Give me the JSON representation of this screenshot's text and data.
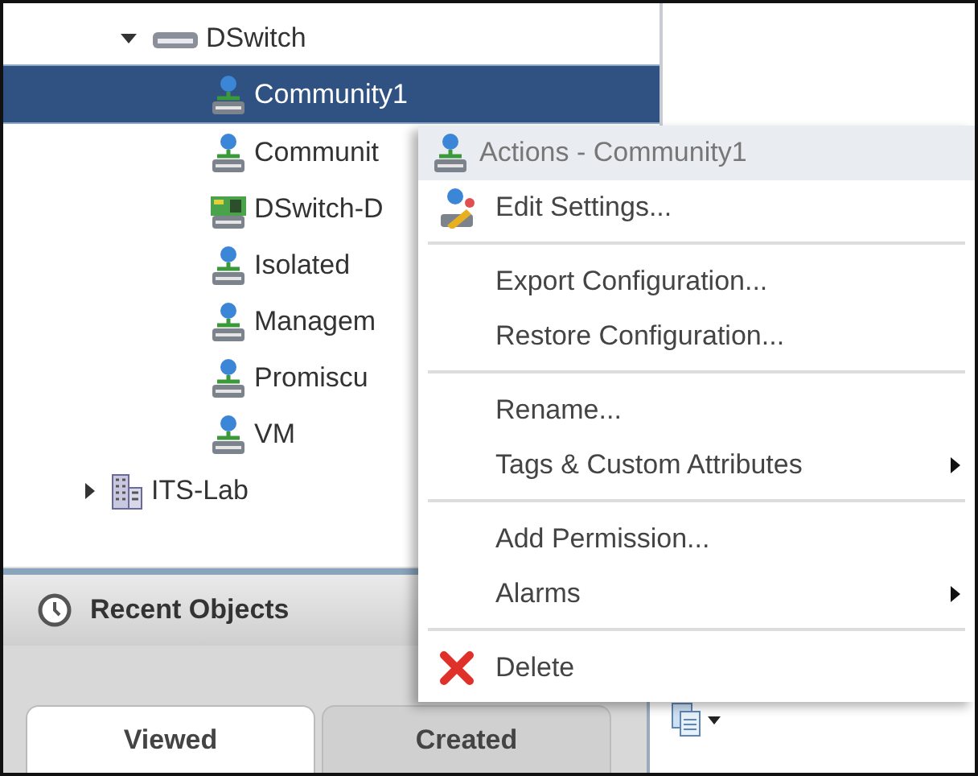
{
  "tree": {
    "items": [
      {
        "label": "DSwitch",
        "kind": "switch",
        "expanded": true,
        "selected": false,
        "children": [
          {
            "label": "Community1",
            "kind": "portgroup",
            "selected": true
          },
          {
            "label": "Communit",
            "kind": "portgroup",
            "selected": false
          },
          {
            "label": "DSwitch-D",
            "kind": "uplink",
            "selected": false
          },
          {
            "label": "Isolated",
            "kind": "portgroup",
            "selected": false
          },
          {
            "label": "Managem",
            "kind": "portgroup",
            "selected": false
          },
          {
            "label": "Promiscu",
            "kind": "portgroup",
            "selected": false
          },
          {
            "label": "VM",
            "kind": "portgroup",
            "selected": false
          }
        ]
      },
      {
        "label": "ITS-Lab",
        "kind": "datacenter",
        "expanded": false,
        "selected": false
      }
    ]
  },
  "recent_objects": {
    "title": "Recent Objects",
    "tabs": [
      {
        "label": "Viewed",
        "selected": true
      },
      {
        "label": "Created",
        "selected": false
      }
    ]
  },
  "context_menu": {
    "title": "Actions - Community1",
    "groups": [
      [
        {
          "label": "Edit Settings...",
          "kind": "edit"
        }
      ],
      [
        {
          "label": "Export Configuration...",
          "kind": "plain"
        },
        {
          "label": "Restore Configuration...",
          "kind": "plain"
        }
      ],
      [
        {
          "label": "Rename...",
          "kind": "plain"
        },
        {
          "label": "Tags & Custom Attributes",
          "kind": "submenu"
        }
      ],
      [
        {
          "label": "Add Permission...",
          "kind": "plain"
        },
        {
          "label": "Alarms",
          "kind": "submenu"
        }
      ],
      [
        {
          "label": "Delete",
          "kind": "delete"
        }
      ]
    ]
  }
}
